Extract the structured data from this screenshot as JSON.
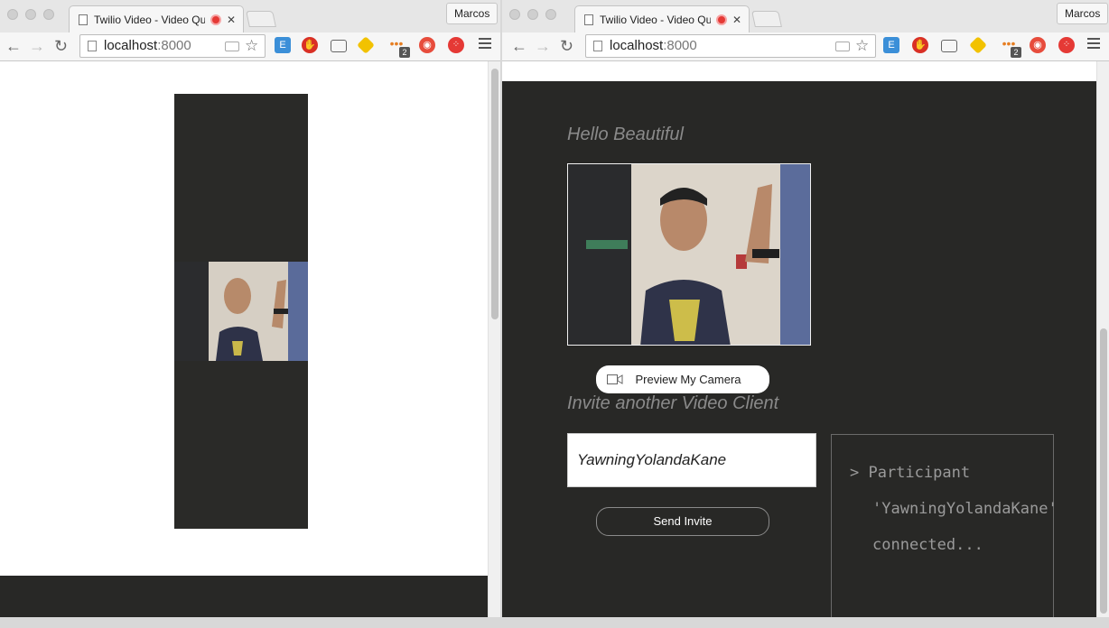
{
  "left_window": {
    "tab_title": "Twilio Video - Video Qui",
    "profile_name": "Marcos",
    "url_host": "localhost",
    "url_port": ":8000",
    "ext_badge": "2"
  },
  "right_window": {
    "tab_title": "Twilio Video - Video Qui",
    "profile_name": "Marcos",
    "url_host": "localhost",
    "url_port": ":8000",
    "ext_badge": "2",
    "greeting": "Hello Beautiful",
    "preview_button_label": "Preview My Camera",
    "invite_heading": "Invite another Video Client",
    "invite_input_value": "YawningYolandaKane",
    "send_invite_label": "Send Invite",
    "log_lines": [
      "> Participant",
      "'YawningYolandaKane'",
      "connected..."
    ]
  },
  "colors": {
    "panel_dark": "#282826",
    "muted_text": "#8a8a8a",
    "record_red": "#e53935"
  },
  "icons": [
    "document-icon",
    "record-icon",
    "close-icon",
    "back-arrow-icon",
    "forward-arrow-icon",
    "reload-icon",
    "camera-icon",
    "star-icon",
    "menu-icon",
    "video-camera-icon"
  ]
}
